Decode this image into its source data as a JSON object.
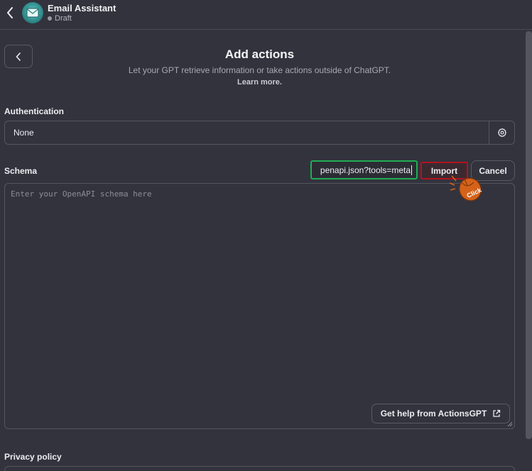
{
  "header": {
    "title": "Email Assistant",
    "status": "Draft"
  },
  "page": {
    "title": "Add actions",
    "subtitle": "Let your GPT retrieve information or take actions outside of ChatGPT.",
    "learn_more": "Learn more."
  },
  "authentication": {
    "label": "Authentication",
    "value": "None"
  },
  "schema": {
    "label": "Schema",
    "url_value": "penapi.json?tools=meta",
    "import_label": "Import",
    "cancel_label": "Cancel",
    "placeholder": "Enter your OpenAPI schema here",
    "help_label": "Get help from ActionsGPT"
  },
  "annotation": {
    "click_text": "Click"
  },
  "privacy": {
    "label": "Privacy policy"
  },
  "colors": {
    "background": "#33333d",
    "url_highlight": "#1fae52",
    "import_highlight": "#b3121f",
    "cursor": "#d4621a"
  }
}
